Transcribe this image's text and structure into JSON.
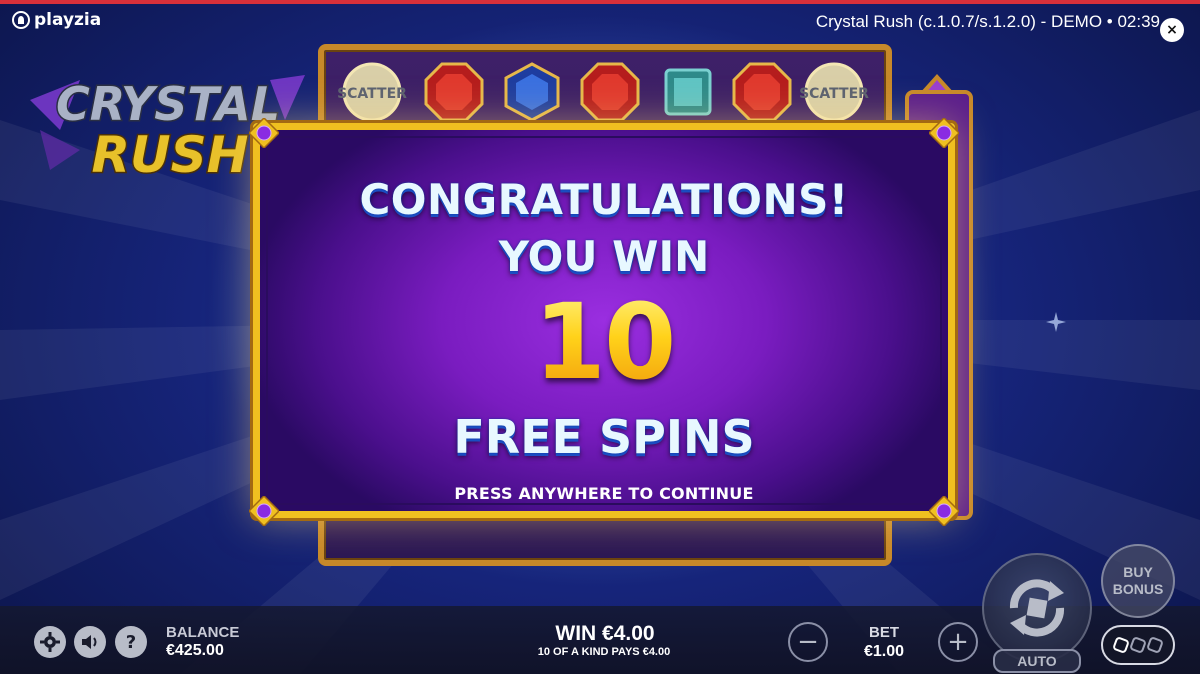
{
  "brand": {
    "name": "playzia"
  },
  "header": {
    "game_title": "Crystal Rush (c.1.0.7/s.1.2.0) - DEMO • 02:39",
    "close_label": "×"
  },
  "logo": {
    "line1": "CRYSTAL",
    "line2": "RUSH"
  },
  "reels": {
    "scatter_label": "SCATTER"
  },
  "popup": {
    "title": "CONGRATULATIONS!",
    "subtitle": "YOU WIN",
    "count": "10",
    "prize": "FREE SPINS",
    "instruction": "PRESS ANYWHERE TO CONTINUE"
  },
  "bottom_bar": {
    "help_label": "?",
    "balance_label": "BALANCE",
    "balance_value": "€425.00",
    "win_label": "WIN €4.00",
    "win_detail": "10 OF A KIND PAYS €4.00",
    "bet_label": "BET",
    "bet_value": "€1.00",
    "minus_label": "−",
    "plus_label": "+",
    "auto_label": "AUTO",
    "buy_bonus_line1": "BUY",
    "buy_bonus_line2": "BONUS"
  },
  "colors": {
    "frame_gold": "#f0c020",
    "popup_purple": "#7a1cc0",
    "number_yellow": "#ffd21a",
    "text_ice": "#e8f8ff",
    "top_strip": "#d8303a"
  }
}
